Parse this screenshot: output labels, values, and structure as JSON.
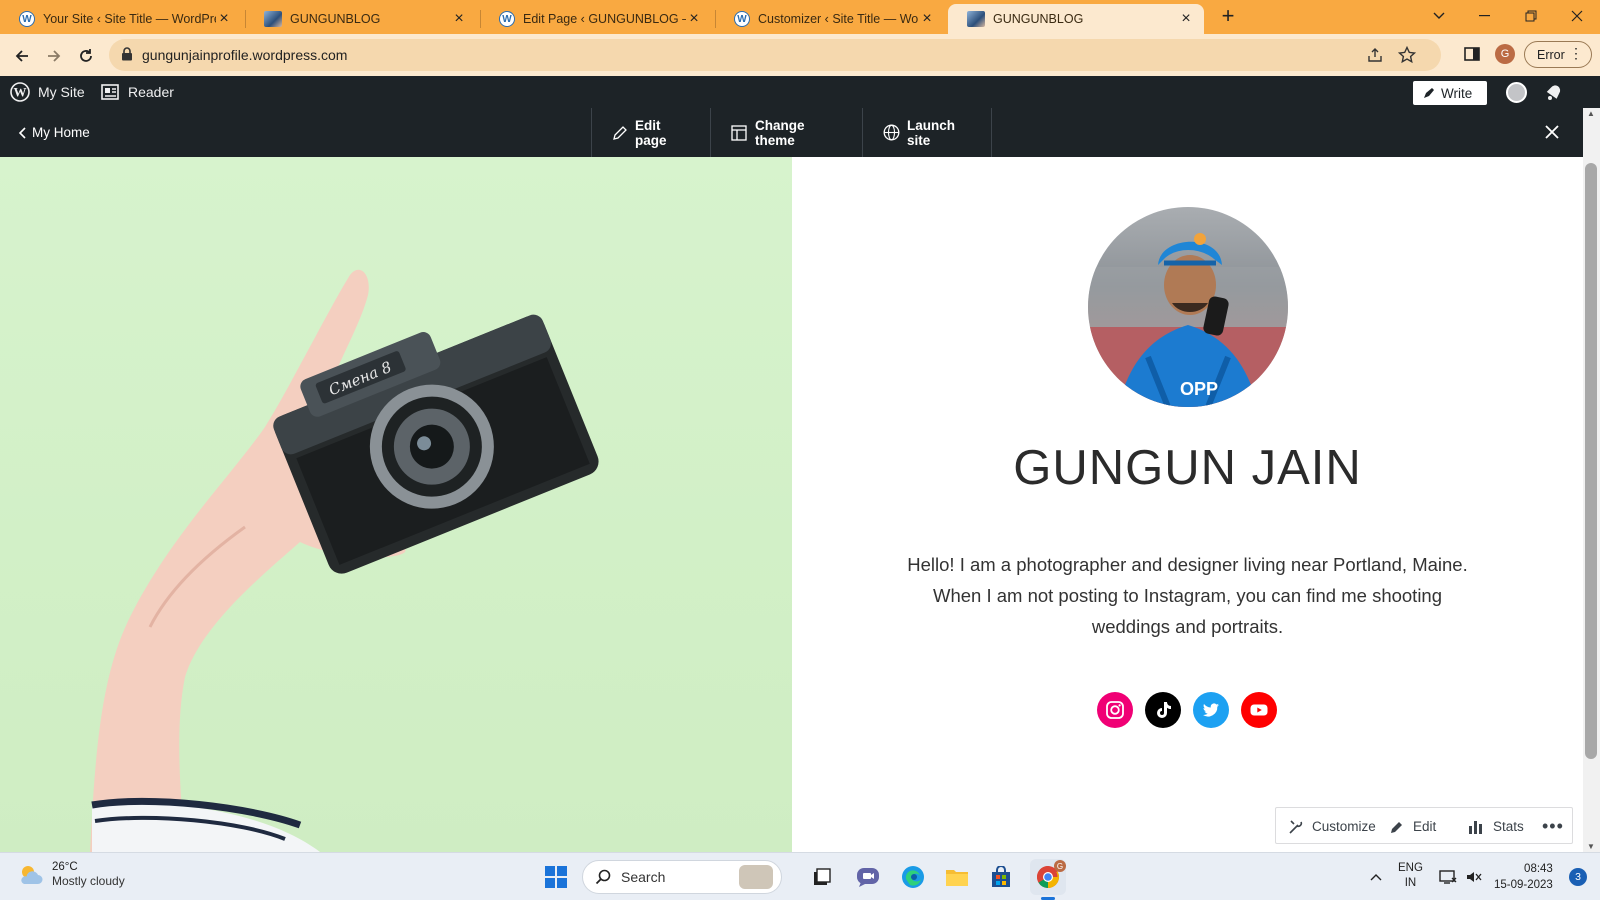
{
  "browser": {
    "tabs": [
      {
        "title": "Your Site ‹ Site Title — WordPress",
        "favicon": "wordpress-icon",
        "active": false
      },
      {
        "title": "GUNGUNBLOG",
        "favicon": "profile-image-icon",
        "active": false
      },
      {
        "title": "Edit Page ‹ GUNGUNBLOG — WordPress",
        "favicon": "wordpress-icon",
        "active": false
      },
      {
        "title": "Customizer ‹ Site Title — WordPress",
        "favicon": "wordpress-icon",
        "active": false
      },
      {
        "title": "GUNGUNBLOG",
        "favicon": "profile-image-icon",
        "active": true
      }
    ],
    "url": "gungunjainprofile.wordpress.com",
    "profile_initial": "G",
    "error_label": "Error",
    "accent_color": "#f9a941"
  },
  "wp_admin_bar": {
    "my_site": "My Site",
    "reader": "Reader",
    "write": "Write"
  },
  "preview_bar": {
    "my_home": "My Home",
    "edit_page": "Edit page",
    "change_theme": "Change theme",
    "launch_site": "Launch site"
  },
  "page": {
    "site_name": "GUNGUN JAIN",
    "bio": "Hello! I am a photographer and designer living near Portland, Maine. When I am not posting to Instagram, you can find me shooting weddings and portraits.",
    "social": [
      {
        "name": "instagram-icon",
        "color": "#f00075"
      },
      {
        "name": "tiktok-icon",
        "color": "#000000"
      },
      {
        "name": "twitter-icon",
        "color": "#1da1f2"
      },
      {
        "name": "youtube-icon",
        "color": "#ff0000"
      }
    ],
    "hero_background": "#d5f2ca"
  },
  "floating_bar": {
    "customize": "Customize",
    "edit": "Edit",
    "stats": "Stats"
  },
  "taskbar": {
    "temperature": "26°C",
    "weather": "Mostly cloudy",
    "search_placeholder": "Search",
    "language": "ENG",
    "region": "IN",
    "time": "08:43",
    "date": "15-09-2023",
    "notification_count": "3"
  }
}
